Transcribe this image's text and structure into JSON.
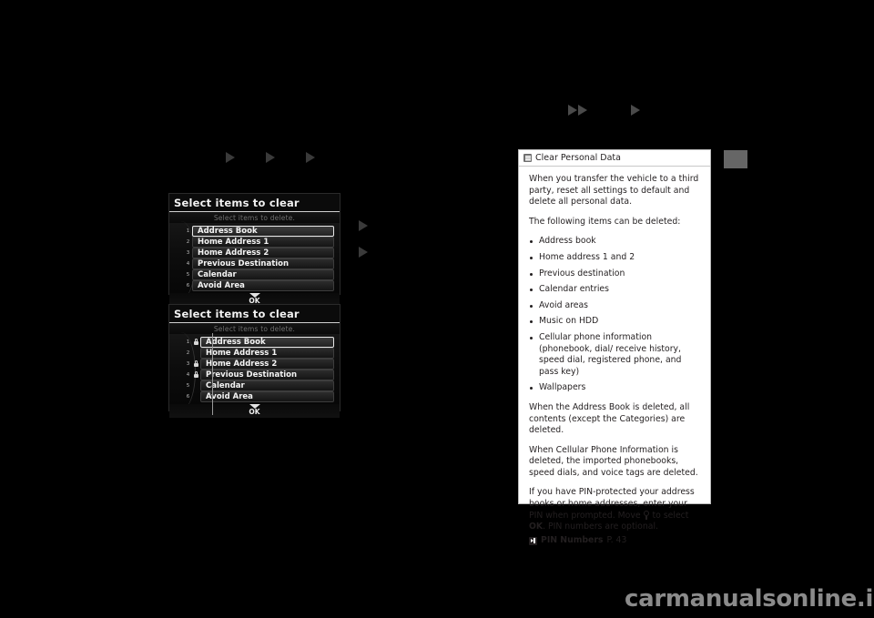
{
  "page": {
    "background": "#000000",
    "watermark": "carmanualsonline.info"
  },
  "flow_arrows": {
    "left_row": {
      "count": 3,
      "color": "#3a3a3a"
    },
    "right_row": {
      "count": 3,
      "color": "#4a4a4a"
    },
    "mid_column": {
      "count": 2,
      "color": "#3a3a3a"
    }
  },
  "nav_screens": [
    {
      "id": "select-items-to-clear-1",
      "title": "Select items to clear",
      "subtitle": "Select items to delete.",
      "ok_label": "OK",
      "rows": [
        {
          "num": "1",
          "label": "Address Book",
          "locked": false,
          "selected": true
        },
        {
          "num": "2",
          "label": "Home Address 1",
          "locked": false,
          "selected": false
        },
        {
          "num": "3",
          "label": "Home Address 2",
          "locked": false,
          "selected": false
        },
        {
          "num": "4",
          "label": "Previous Destination",
          "locked": false,
          "selected": false
        },
        {
          "num": "5",
          "label": "Calendar",
          "locked": false,
          "selected": false
        },
        {
          "num": "6",
          "label": "Avoid Area",
          "locked": false,
          "selected": false
        }
      ]
    },
    {
      "id": "select-items-to-clear-2",
      "title": "Select items to clear",
      "subtitle": "Select items to delete.",
      "ok_label": "OK",
      "rows": [
        {
          "num": "1",
          "label": "Address Book",
          "locked": true,
          "selected": true
        },
        {
          "num": "2",
          "label": "Home Address 1",
          "locked": false,
          "selected": false
        },
        {
          "num": "3",
          "label": "Home Address 2",
          "locked": true,
          "selected": false
        },
        {
          "num": "4",
          "label": "Previous Destination",
          "locked": true,
          "selected": false
        },
        {
          "num": "5",
          "label": "Calendar",
          "locked": false,
          "selected": false
        },
        {
          "num": "6",
          "label": "Avoid Area",
          "locked": false,
          "selected": false
        }
      ]
    }
  ],
  "info_panel": {
    "header_icon": "note-icon",
    "title": "Clear Personal Data",
    "paragraphs_1": [
      "When you transfer the vehicle to a third party, reset all settings to default and delete all personal data.",
      "The following items can be deleted:"
    ],
    "bullets": [
      "Address book",
      "Home address 1 and 2",
      "Previous destination",
      "Calendar entries",
      "Avoid areas",
      "Music on HDD",
      "Cellular phone information (phonebook, dial/ receive history, speed dial, registered phone, and pass key)",
      "Wallpapers"
    ],
    "paragraphs_2": [
      "When the Address Book is deleted, all contents (except the Categories) are deleted.",
      "When Cellular Phone Information is deleted, the imported phonebooks, speed dials, and voice tags are deleted."
    ],
    "pin_note_part1": "If you have PIN-protected your address books or home addresses, enter your PIN when prompted. Move",
    "pin_note_part2": "to select",
    "pin_note_ok": "OK",
    "pin_note_part3": ". PIN numbers are optional.",
    "reference": {
      "label": "PIN Numbers",
      "page": "P. 43"
    }
  }
}
